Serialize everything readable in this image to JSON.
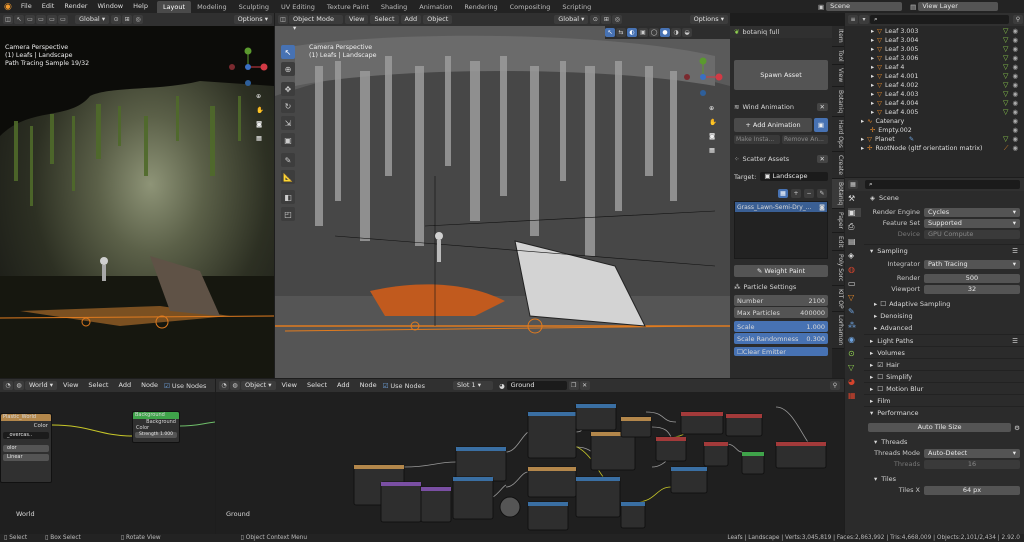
{
  "topbar": {
    "menus": [
      "File",
      "Edit",
      "Render",
      "Window",
      "Help"
    ],
    "workspaces": [
      "Layout",
      "Modeling",
      "Sculpting",
      "UV Editing",
      "Texture Paint",
      "Shading",
      "Animation",
      "Rendering",
      "Compositing",
      "Scripting"
    ],
    "active_workspace": "Layout",
    "scene": "Scene",
    "view_layer": "View Layer"
  },
  "left_viewport": {
    "transform_orientation": "Global",
    "options_label": "Options",
    "overlay_lines": [
      "Camera Perspective",
      "(1) Leafs | Landscape",
      "Path Tracing Sample 19/32"
    ]
  },
  "main_viewport": {
    "mode": "Object Mode",
    "menus": [
      "View",
      "Select",
      "Add",
      "Object"
    ],
    "transform_orientation": "Global",
    "options_label": "Options",
    "overlay_lines": [
      "Camera Perspective",
      "(1) Leafs | Landscape"
    ]
  },
  "botaniq": {
    "title": "botaniq full",
    "spawn_asset": "Spawn Asset",
    "wind_title": "Wind Animation",
    "add_animation": "Add Animation",
    "make_instance": "Make Insta...",
    "remove_animation": "Remove An...",
    "scatter_title": "Scatter Assets",
    "target_label": "Target:",
    "target_value": "Landscape",
    "scatter_item": "Grass_Lawn-Semi-Dry_...",
    "weight_paint": "Weight Paint",
    "particle_title": "Particle Settings",
    "fields": [
      {
        "label": "Number",
        "value": "2100"
      },
      {
        "label": "Max Particles",
        "value": "400000"
      },
      {
        "label": "Scale",
        "value": "1.000"
      },
      {
        "label": "Scale Randomness",
        "value": "0.300"
      }
    ],
    "clear_label": "Clear Emitter"
  },
  "side_tabs": [
    "Item",
    "Tool",
    "View",
    "Botaniq",
    "Hard Ops",
    "Create",
    "Botaniq",
    "Paper",
    "Edit",
    "Poly Sorc",
    "KIT OP",
    "Lorhamon"
  ],
  "outliner": {
    "search_placeholder": "",
    "items": [
      {
        "name": "Leaf 3.003"
      },
      {
        "name": "Leaf 3.004"
      },
      {
        "name": "Leaf 3.005"
      },
      {
        "name": "Leaf 3.006"
      },
      {
        "name": "Leaf 4"
      },
      {
        "name": "Leaf 4.001"
      },
      {
        "name": "Leaf 4.002"
      },
      {
        "name": "Leaf 4.003"
      },
      {
        "name": "Leaf 4.004"
      },
      {
        "name": "Leaf 4.005"
      },
      {
        "name": "Catenary"
      },
      {
        "name": "Empty.002"
      },
      {
        "name": "Planet"
      },
      {
        "name": "RootNode (gltf orientation matrix)"
      }
    ]
  },
  "properties": {
    "scene_label": "Scene",
    "render_engine_label": "Render Engine",
    "render_engine": "Cycles",
    "feature_set_label": "Feature Set",
    "feature_set": "Supported",
    "device_label": "Device",
    "device": "GPU Compute",
    "sampling": "Sampling",
    "integrator_label": "Integrator",
    "integrator": "Path Tracing",
    "render_label": "Render",
    "render_samples": "500",
    "viewport_label": "Viewport",
    "viewport_samples": "32",
    "adaptive_sampling": "Adaptive Sampling",
    "denoising": "Denoising",
    "advanced": "Advanced",
    "light_paths": "Light Paths",
    "volumes": "Volumes",
    "hair": "Hair",
    "simplify": "Simplify",
    "motion_blur": "Motion Blur",
    "film": "Film",
    "performance": "Performance",
    "auto_tile_size": "Auto Tile Size",
    "threads": "Threads",
    "threads_mode_label": "Threads Mode",
    "threads_mode": "Auto-Detect",
    "threads_label": "Threads",
    "threads_value": "16",
    "tiles": "Tiles",
    "tiles_x_label": "Tiles X",
    "tiles_x": "64 px"
  },
  "world_editor": {
    "world": "World",
    "menus": [
      "View",
      "Select",
      "Add",
      "Node"
    ],
    "use_nodes": "Use Nodes",
    "node_left_title": "Plastic_World",
    "node_left_color": "Color",
    "node_left_field": "_overcas..",
    "node_left_select1": "olor",
    "node_left_select2": "Linear",
    "bg_title": "Background",
    "bg_out": "Background",
    "bg_color": "Color",
    "bg_strength": "Strength",
    "bg_strength_val": "1.000",
    "footer": "World"
  },
  "shader_editor": {
    "object": "Object",
    "menus": [
      "View",
      "Select",
      "Add",
      "Node"
    ],
    "use_nodes": "Use Nodes",
    "slot": "Slot 1",
    "material": "Ground",
    "footer": "Ground"
  },
  "status": {
    "left": [
      "Select",
      "Box Select",
      "Rotate View",
      "Object Context Menu"
    ],
    "right": "Leafs | Landscape | Verts:3,045,819 | Faces:2,863,992 | Tris:4,668,009 | Objects:2,101/2,434 | 2.92.0"
  }
}
